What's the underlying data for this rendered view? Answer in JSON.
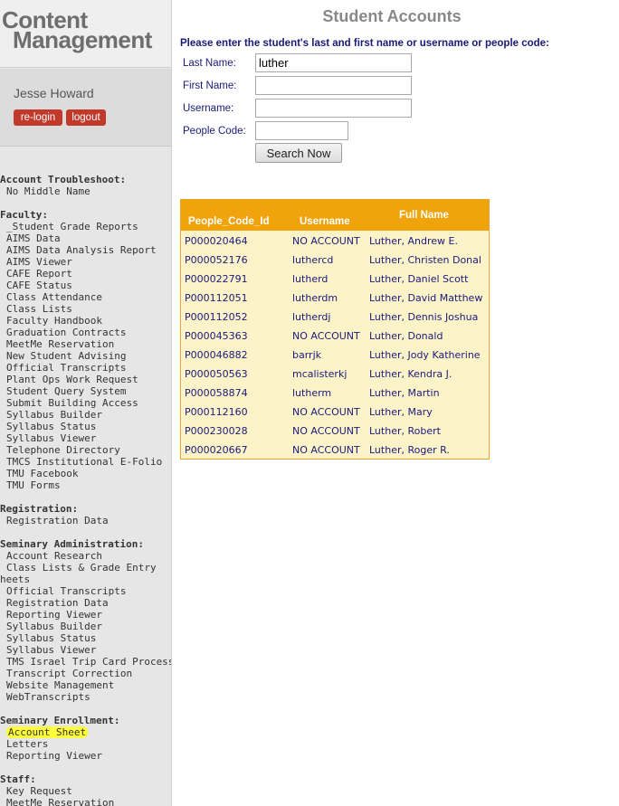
{
  "sidebar": {
    "logo_line1": "Content",
    "logo_line2": "Management",
    "user_name": "Jesse Howard",
    "relogin_label": "re-login",
    "logout_label": "logout",
    "sections": [
      {
        "title": "Account Troubleshoot:",
        "items": [
          "No Middle Name"
        ]
      },
      {
        "title": "Faculty:",
        "items": [
          "_Student Grade Reports",
          "AIMS Data",
          "AIMS Data Analysis Report",
          "AIMS Viewer",
          "CAFE Report",
          "CAFE Status",
          "Class Attendance",
          "Class Lists",
          "Faculty Handbook",
          "Graduation Contracts",
          "MeetMe Reservation",
          "New Student Advising",
          "Official Transcripts",
          "Plant Ops Work Request",
          "Student Query System",
          "Submit Building Access",
          "Syllabus Builder",
          "Syllabus Status",
          "Syllabus Viewer",
          "Telephone Directory",
          "TMCS Institutional E-Folio",
          "TMU Facebook",
          "TMU Forms"
        ]
      },
      {
        "title": "Registration:",
        "items": [
          "Registration Data"
        ]
      },
      {
        "title": "Seminary Administration:",
        "items": [
          "Account Research",
          "Class Lists & Grade Entry",
          "heets",
          "Official Transcripts",
          "Registration Data",
          "Reporting Viewer",
          "Syllabus Builder",
          "Syllabus Status",
          "Syllabus Viewer",
          "TMS Israel Trip Card Processing",
          "Transcript Correction",
          "Website Management",
          "WebTranscripts"
        ]
      },
      {
        "title": "Seminary Enrollment:",
        "items": [
          "Account Sheet",
          "Letters",
          "Reporting Viewer"
        ]
      },
      {
        "title": "Staff:",
        "items": [
          "Key Request",
          "MeetMe Reservation"
        ]
      }
    ]
  },
  "main": {
    "title": "Student Accounts",
    "instructions": "Please enter the student's last and first name or username or people code:",
    "form": {
      "last_name_label": "Last Name:",
      "last_name_value": "luther",
      "first_name_label": "First Name:",
      "first_name_value": "",
      "username_label": "Username:",
      "username_value": "",
      "people_code_label": "People Code:",
      "people_code_value": "",
      "search_button": "Search Now"
    },
    "results": {
      "headers": [
        "People_Code_Id",
        "Username",
        "Full Name"
      ],
      "rows": [
        [
          "P000020464",
          "NO ACCOUNT",
          "Luther, Andrew E."
        ],
        [
          "P000052176",
          "luthercd",
          "Luther, Christen Donal"
        ],
        [
          "P000022791",
          "lutherd",
          "Luther, Daniel Scott"
        ],
        [
          "P000112051",
          "lutherdm",
          "Luther, David Matthew"
        ],
        [
          "P000112052",
          "lutherdj",
          "Luther, Dennis Joshua"
        ],
        [
          "P000045363",
          "NO ACCOUNT",
          "Luther, Donald"
        ],
        [
          "P000046882",
          "barrjk",
          "Luther, Jody Katherine"
        ],
        [
          "P000050563",
          "mcalisterkj",
          "Luther, Kendra J."
        ],
        [
          "P000058874",
          "lutherm",
          "Luther, Martin"
        ],
        [
          "P000112160",
          "NO ACCOUNT",
          "Luther, Mary"
        ],
        [
          "P000230028",
          "NO ACCOUNT",
          "Luther, Robert"
        ],
        [
          "P000020667",
          "NO ACCOUNT",
          "Luther, Roger R."
        ]
      ]
    }
  },
  "colors": {
    "accent_orange": "#f0a30a",
    "table_bg": "#fdf3c8",
    "text_navy": "#1a1a7a",
    "button_red": "#c0392b",
    "highlight_yellow": "#ffff3c"
  }
}
